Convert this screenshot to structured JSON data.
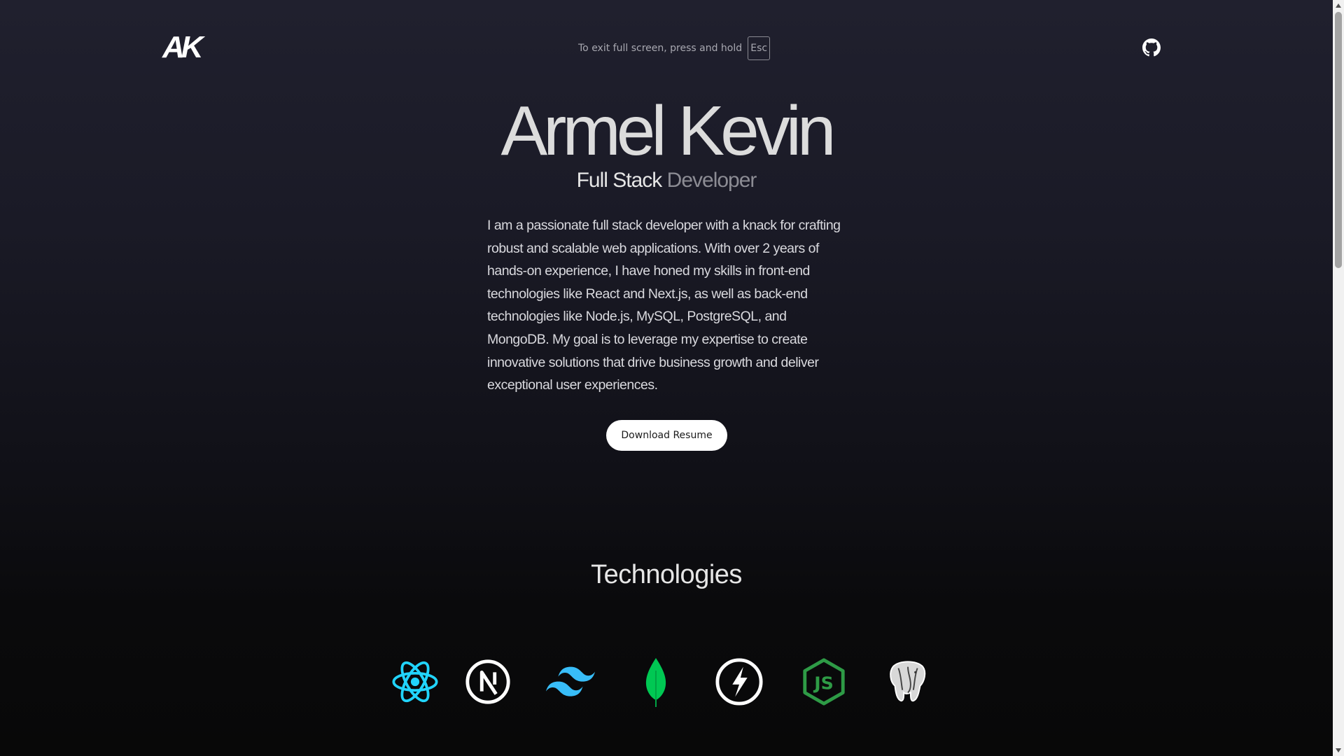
{
  "header": {
    "logo_text": "AK",
    "fullscreen_notice": "To exit full screen, press and hold",
    "fullscreen_key": "Esc",
    "github_icon": "github-icon"
  },
  "hero": {
    "name": "Armel Kevin",
    "role_part1": "Full Stack",
    "role_part2": "Developer",
    "bio": "I am a passionate full stack developer with a knack for crafting robust and scalable web applications. With over 2 years of hands-on experience, I have honed my skills in front-end technologies like React and Next.js, as well as back-end technologies like Node.js, MySQL, PostgreSQL, and MongoDB. My goal is to leverage my expertise to create innovative solutions that drive business growth and deliver exceptional user experiences.",
    "resume_button": "Download Resume"
  },
  "technologies": {
    "title": "Technologies",
    "icons": [
      {
        "name": "react-icon",
        "color": "#21d4fd"
      },
      {
        "name": "nextjs-icon",
        "color": "#ffffff"
      },
      {
        "name": "tailwind-icon",
        "color": "#38bdf8"
      },
      {
        "name": "mongodb-icon",
        "color": "#00c853"
      },
      {
        "name": "express-icon",
        "color": "#ffffff"
      },
      {
        "name": "nodejs-icon",
        "color": "#2e9b46"
      },
      {
        "name": "postgresql-icon",
        "color": "#ffffff"
      }
    ]
  },
  "colors": {
    "background_top": "#20202e",
    "background_bottom": "#080808",
    "text_primary": "#e6e6e6",
    "text_muted": "#8c8c94",
    "button_bg": "#ffffff"
  }
}
